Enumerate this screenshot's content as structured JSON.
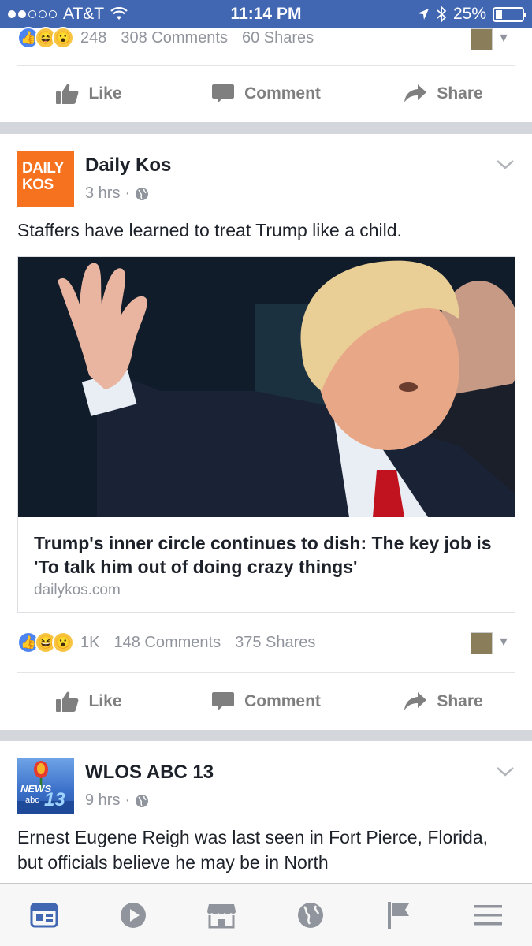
{
  "status_bar": {
    "carrier": "AT&T",
    "time": "11:14 PM",
    "battery": "25%",
    "battery_level": 0.25
  },
  "prev_post": {
    "reaction_count": "248",
    "comments": "308 Comments",
    "shares": "60 Shares"
  },
  "actions": {
    "like": "Like",
    "comment": "Comment",
    "share": "Share"
  },
  "post1": {
    "page_name": "Daily Kos",
    "logo_line1": "DAILY",
    "logo_line2": "KOS",
    "time": "3 hrs",
    "text": "Staffers have learned to treat Trump like a child.",
    "link_title": "Trump's inner circle continues to dish: The key job is 'To talk him out of doing crazy things'",
    "link_domain": "dailykos.com",
    "reaction_count": "1K",
    "comments": "148 Comments",
    "shares": "375 Shares"
  },
  "post2": {
    "page_name": "WLOS ABC 13",
    "logo_news": "NEWS",
    "logo_abc": "abc",
    "logo_num": "13",
    "time": "9 hrs",
    "text": "Ernest Eugene Reigh was last seen in Fort Pierce, Florida, but officials believe he may be in North"
  },
  "colors": {
    "brand": "#4267b2",
    "dailykos": "#f6721e",
    "muted": "#90949c"
  }
}
